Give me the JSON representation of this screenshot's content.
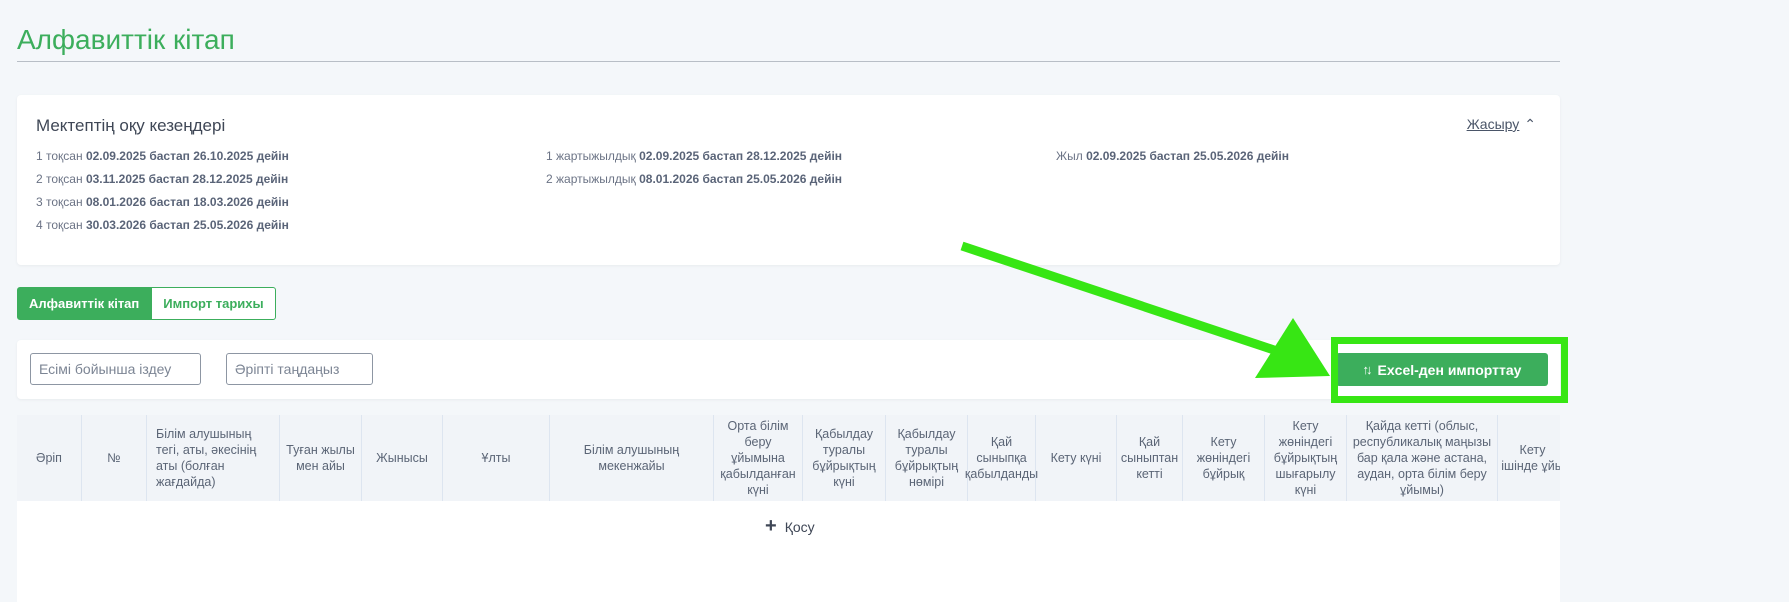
{
  "page": {
    "title": "Алфавиттік кітап"
  },
  "periods": {
    "title": "Мектептің оқу кезеңдері",
    "hide_label": "Жасыру",
    "quarters": [
      {
        "label": "1 тоқсан",
        "range": "02.09.2025 бастап 26.10.2025 дейін"
      },
      {
        "label": "2 тоқсан",
        "range": "03.11.2025 бастап 28.12.2025 дейін"
      },
      {
        "label": "3 тоқсан",
        "range": "08.01.2026 бастап 18.03.2026 дейін"
      },
      {
        "label": "4 тоқсан",
        "range": "30.03.2026 бастап 25.05.2026 дейін"
      }
    ],
    "halves": [
      {
        "label": "1 жартыжылдық",
        "range": "02.09.2025 бастап 28.12.2025 дейін"
      },
      {
        "label": "2 жартыжылдық",
        "range": "08.01.2026 бастап 25.05.2026 дейін"
      }
    ],
    "year": {
      "label": "Жыл",
      "range": "02.09.2025 бастап 25.05.2026 дейін"
    }
  },
  "tabs": [
    {
      "label": "Алфавиттік кітап",
      "active": true
    },
    {
      "label": "Импорт тарихы",
      "active": false
    }
  ],
  "filters": {
    "search_placeholder": "Есімі бойынша іздеу",
    "letter_placeholder": "Әріпті таңдаңыз",
    "import_button": "Excel-ден импорттау"
  },
  "table": {
    "columns": [
      "Әріп",
      "№",
      "Білім алушының тегі, аты, әкесінің аты (болған жағдайда)",
      "Туған жылы мен айы",
      "Жынысы",
      "Ұлты",
      "Білім алушының мекенжайы",
      "Орта білім беру ұйымына қабылданған күні",
      "Қабылдау туралы бұйрықтың күні",
      "Қабылдау туралы бұйрықтың нөмірі",
      "Қай сыныпқа қабылданды",
      "Кету күні",
      "Қай сыныптан кетті",
      "Кету жөніндегі бұйрық",
      "Кету жөніндегі бұйрықтың шығарылу күні",
      "Қайда кетті (облыс, республикалық маңызы бар қала және астана, аудан, орта білім беру ұйымы)",
      "Кету ішінде ұйы"
    ],
    "add_label": "Қосу"
  },
  "colors": {
    "accent": "#3cae5c",
    "highlight": "#37e614"
  }
}
